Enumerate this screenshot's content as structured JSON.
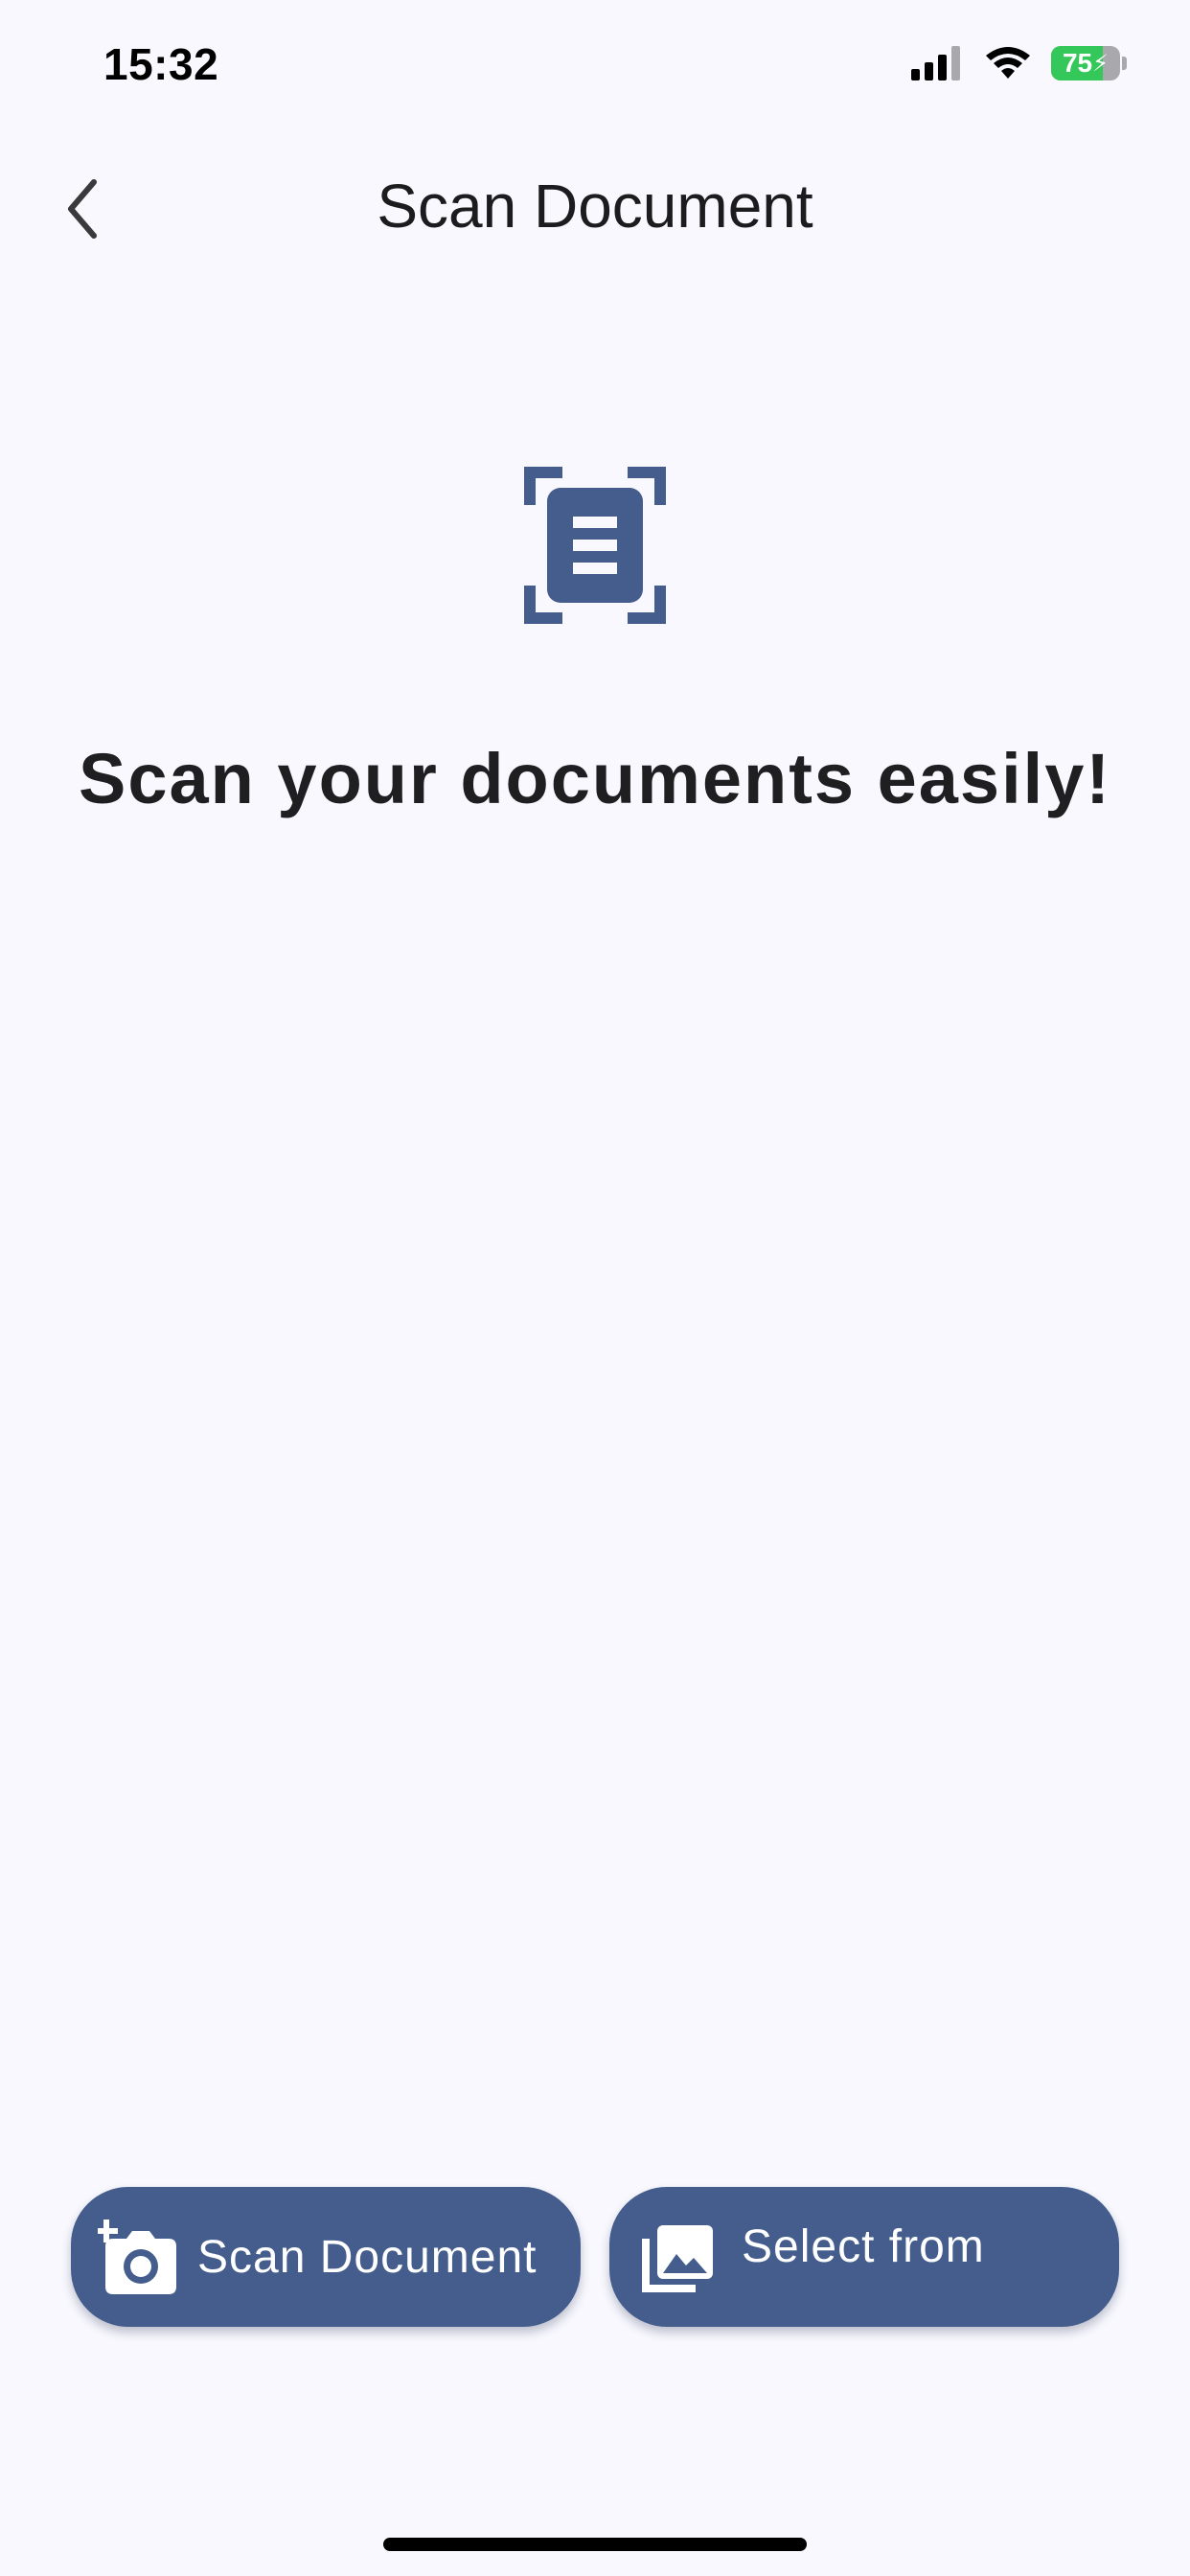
{
  "status_bar": {
    "time": "15:32",
    "battery_level": "75",
    "battery_fraction": 0.75,
    "icons": [
      "cellular-signal-icon",
      "wifi-icon",
      "battery-charging-icon"
    ]
  },
  "nav": {
    "back_icon": "chevron-left-icon",
    "title": "Scan Document"
  },
  "hero": {
    "icon": "document-scanner-icon",
    "headline": "Scan your documents easily!"
  },
  "actions": {
    "scan": {
      "icon": "add-camera-icon",
      "label": "Scan Document"
    },
    "gallery": {
      "icon": "photo-library-icon",
      "label": "Select from Gallery"
    }
  },
  "colors": {
    "accent": "#445d8d",
    "background": "#f8f8fe",
    "battery_green": "#34c759"
  }
}
